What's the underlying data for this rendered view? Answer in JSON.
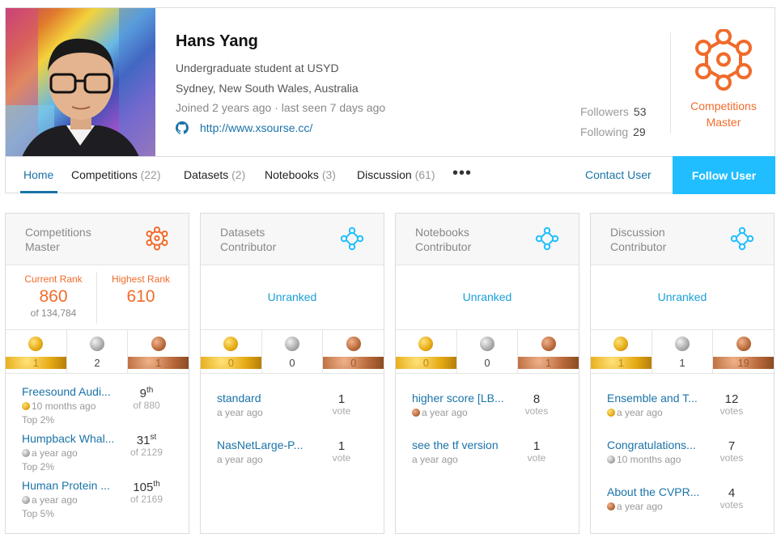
{
  "profile": {
    "name": "Hans Yang",
    "bio": "Undergraduate student at USYD",
    "location": "Sydney, New South Wales, Australia",
    "activity": "Joined 2 years ago · last seen 7 days ago",
    "website": "http://www.xsourse.cc/",
    "followers_label": "Followers",
    "followers_count": "53",
    "following_label": "Following",
    "following_count": "29",
    "tier_line1": "Competitions",
    "tier_line2": "Master"
  },
  "nav": {
    "home": "Home",
    "competitions": "Competitions",
    "competitions_count": "(22)",
    "datasets": "Datasets",
    "datasets_count": "(2)",
    "notebooks": "Notebooks",
    "notebooks_count": "(3)",
    "discussion": "Discussion",
    "discussion_count": "(61)",
    "more": "•••",
    "contact": "Contact User",
    "follow": "Follow User"
  },
  "colors": {
    "accent": "#20beff",
    "link": "#1a73a8",
    "master": "#f06b2b",
    "contributor": "#20beff"
  },
  "cards": {
    "competitions": {
      "title_line1": "Competitions",
      "title_line2": "Master",
      "icon": "competitions-master-icon",
      "current_rank_label": "Current Rank",
      "current_rank": "860",
      "current_rank_total": "of 134,784",
      "highest_rank_label": "Highest Rank",
      "highest_rank": "610",
      "medals": {
        "gold": "1",
        "silver": "2",
        "bronze": "1"
      },
      "entries": [
        {
          "title": "Freesound Audi...",
          "medal": "gold",
          "time": "10 months ago",
          "top": "Top 2%",
          "place": "9",
          "suffix": "th",
          "total": "of 880"
        },
        {
          "title": "Humpback Whal...",
          "medal": "silver",
          "time": "a year ago",
          "top": "Top 2%",
          "place": "31",
          "suffix": "st",
          "total": "of 2129"
        },
        {
          "title": "Human Protein ...",
          "medal": "silver",
          "time": "a year ago",
          "top": "Top 5%",
          "place": "105",
          "suffix": "th",
          "total": "of 2169"
        }
      ]
    },
    "datasets": {
      "title_line1": "Datasets",
      "title_line2": "Contributor",
      "icon": "contributor-icon",
      "unranked": "Unranked",
      "medals": {
        "gold": "0",
        "silver": "0",
        "bronze": "0"
      },
      "entries": [
        {
          "title": "standard",
          "medal": "",
          "time": "a year ago",
          "votes": "1",
          "unit": "vote"
        },
        {
          "title": "NasNetLarge-P...",
          "medal": "",
          "time": "a year ago",
          "votes": "1",
          "unit": "vote"
        }
      ]
    },
    "notebooks": {
      "title_line1": "Notebooks",
      "title_line2": "Contributor",
      "icon": "contributor-icon",
      "unranked": "Unranked",
      "medals": {
        "gold": "0",
        "silver": "0",
        "bronze": "1"
      },
      "entries": [
        {
          "title": "higher score [LB...",
          "medal": "bronze",
          "time": "a year ago",
          "votes": "8",
          "unit": "votes"
        },
        {
          "title": "see the tf version",
          "medal": "",
          "time": "a year ago",
          "votes": "1",
          "unit": "vote"
        }
      ]
    },
    "discussion": {
      "title_line1": "Discussion",
      "title_line2": "Contributor",
      "icon": "contributor-icon",
      "unranked": "Unranked",
      "medals": {
        "gold": "1",
        "silver": "1",
        "bronze": "19"
      },
      "entries": [
        {
          "title": "Ensemble and T...",
          "medal": "gold",
          "time": "a year ago",
          "votes": "12",
          "unit": "votes"
        },
        {
          "title": "Congratulations...",
          "medal": "silver",
          "time": "10 months ago",
          "votes": "7",
          "unit": "votes"
        },
        {
          "title": "About the CVPR...",
          "medal": "bronze",
          "time": "a year ago",
          "votes": "4",
          "unit": "votes"
        }
      ]
    }
  }
}
